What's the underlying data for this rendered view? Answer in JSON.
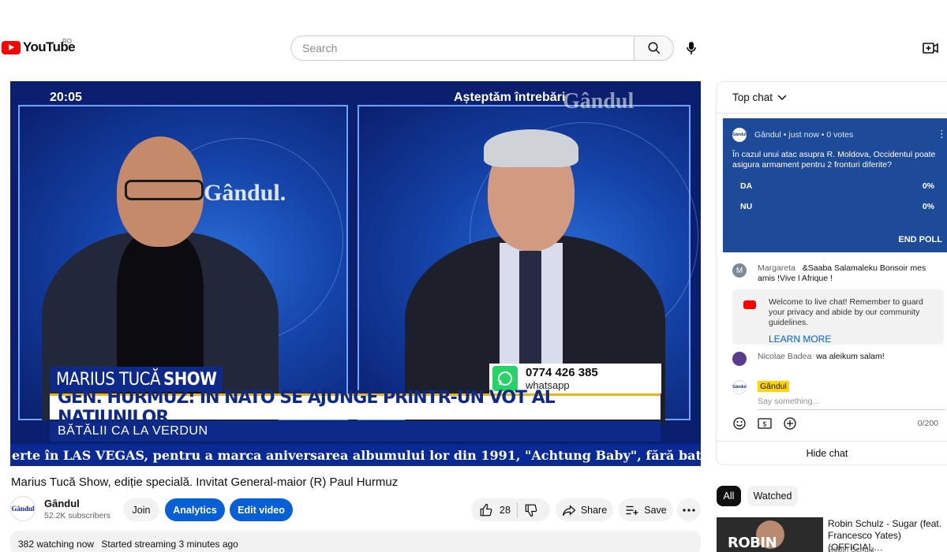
{
  "header": {
    "logo_text": "YouTube",
    "region": "RO",
    "search_placeholder": "Search",
    "search_icon": "search-icon",
    "mic_icon": "mic-icon",
    "create_icon": "create-video-icon"
  },
  "video": {
    "clock": "20:05",
    "asteptam": "Așteptăm întrebări",
    "brand_watermark": "Gândul",
    "brand_center": "Gândul.",
    "show_name_light": "MARIUS TUCĂ",
    "show_name_bold": "SHOW",
    "phone": "0774 426 385",
    "phone_label": "whatsapp",
    "headline": "GEN. HURMUZ: ÎN NATO SE AJUNGE PRINTR-UN VOT AL NAȚIUNILOR",
    "subline": "BĂTĂLII CA LA VERDUN",
    "ticker": "erte în LAS VEGAS, pentru a marca aniversarea albumului lor din 1991, \"Achtung Baby\", fără bateristul Larry Mulle"
  },
  "details": {
    "title": "Marius Tucă Show, ediție specială. Invitat General-maior (R) Paul Hurmuz",
    "channel_name": "Gândul",
    "channel_avatar": "Gândul",
    "subscribers": "52.2K subscribers",
    "join_label": "Join",
    "analytics_label": "Analytics",
    "edit_label": "Edit video",
    "like_count": "28",
    "share_label": "Share",
    "save_label": "Save",
    "watching": "382 watching now",
    "started": "Started streaming 3 minutes ago"
  },
  "chat": {
    "mode": "Top chat",
    "poll": {
      "author": "Gândul",
      "meta": "Gândul • just now • 0 votes",
      "avatar_text": "Gândul",
      "question": "În cazul unui atac asupra R. Moldova, Occidentul poate asigura armament pentru 2 fronturi diferite?",
      "options": [
        {
          "label": "DA",
          "percent": "0%"
        },
        {
          "label": "NU",
          "percent": "0%"
        }
      ],
      "end_label": "END POLL"
    },
    "messages": [
      {
        "author": "Margareta",
        "text": "&Saaba Salamaleku Bonsoir mes amis !Vive l Afrique !",
        "avatar_letter": "M",
        "avatar_color": "#7a8a99"
      },
      {
        "author": "Nicolae Badea",
        "text": "wa aleikum salam!",
        "avatar_color": "#5b3b8c"
      }
    ],
    "welcome": {
      "text": "Welcome to live chat! Remember to guard your privacy and abide by our community guidelines.",
      "learn_more": "LEARN MORE"
    },
    "composer": {
      "author_tag": "Gândul",
      "avatar_text": "Gândul",
      "placeholder": "Say something...",
      "counter": "0/200"
    },
    "hide_label": "Hide chat"
  },
  "recs": {
    "chips": [
      "All",
      "Watched"
    ],
    "item": {
      "thumb_text": "ROBIN SCHULZ",
      "title": "Robin Schulz - Sugar (feat. Francesco Yates) (OFFICIAL…",
      "channel": "Robin Schulz"
    }
  },
  "colors": {
    "brand_red": "#ff0000",
    "accent_blue": "#065fd4",
    "poll_bg": "#1e4a9a",
    "tv_blue": "#0d2a8a"
  }
}
